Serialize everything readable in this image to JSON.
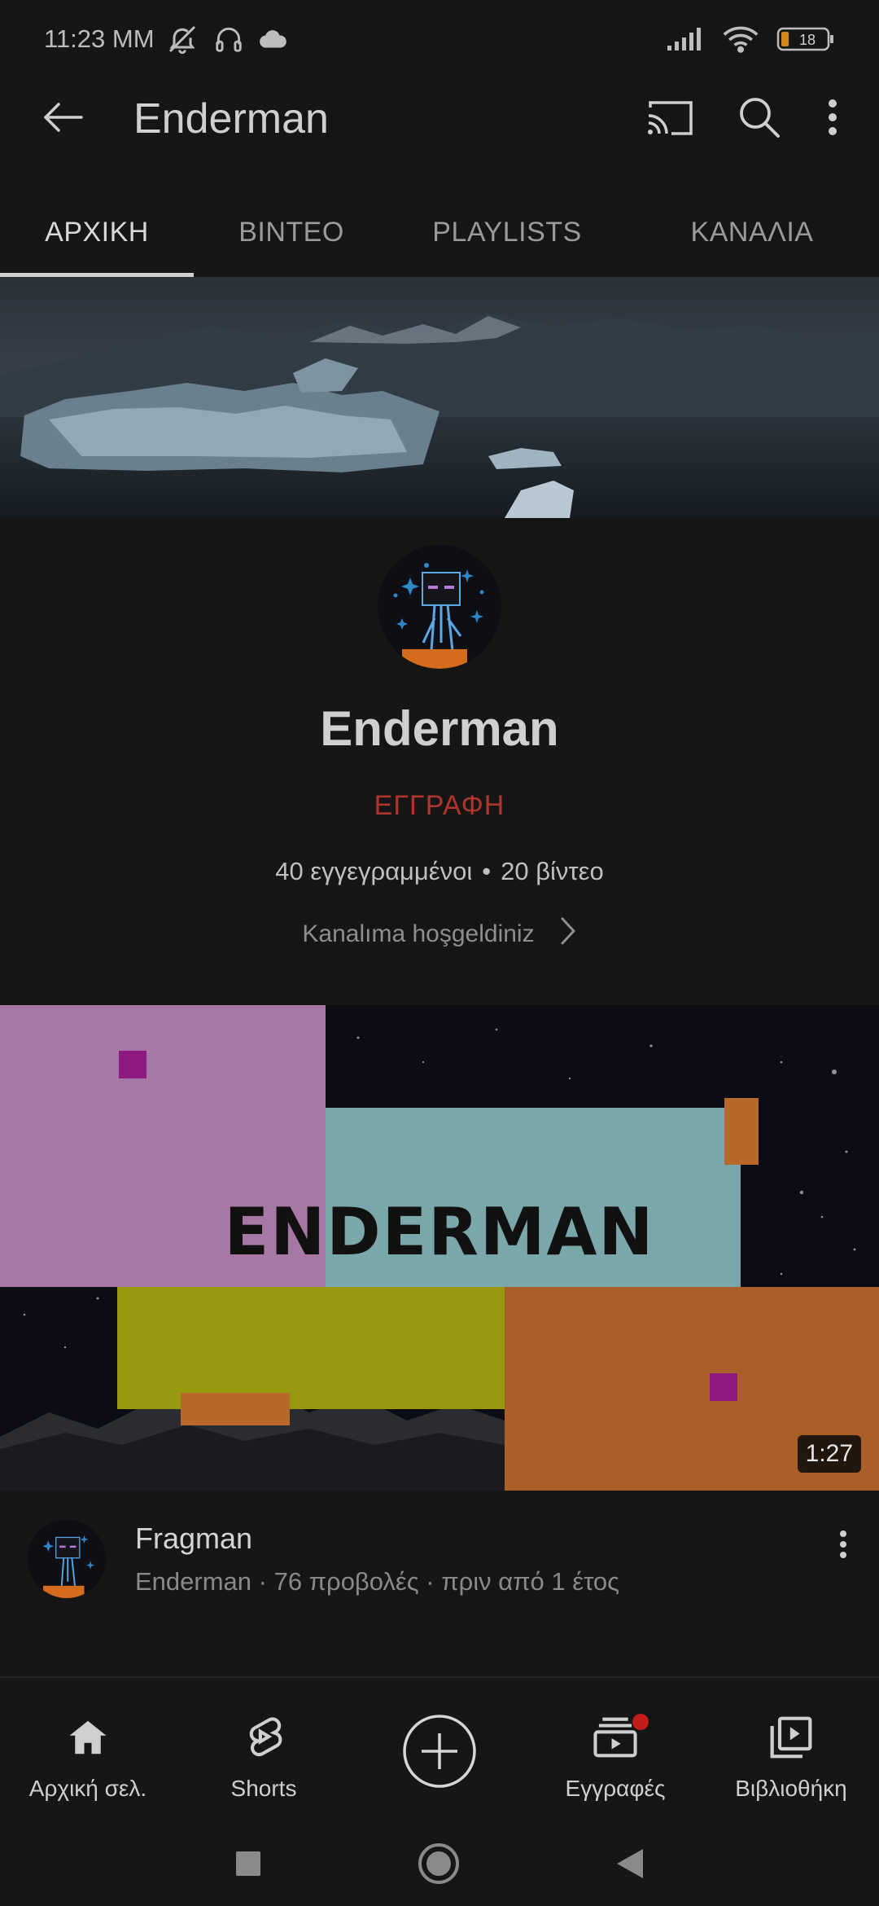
{
  "status_bar": {
    "time": "11:23 ΜΜ",
    "battery_level": "18",
    "icons": [
      "muted-bell-icon",
      "headphones-icon",
      "cloud-icon",
      "signal-icon",
      "wifi-icon",
      "battery-icon"
    ]
  },
  "header": {
    "title": "Enderman",
    "icons": [
      "back-arrow-icon",
      "cast-icon",
      "search-icon",
      "more-vert-icon"
    ]
  },
  "tabs": [
    {
      "label": "ΑΡΧΙΚΗ",
      "active": true
    },
    {
      "label": "ΒΙΝΤΕΟ",
      "active": false
    },
    {
      "label": "PLAYLISTS",
      "active": false
    },
    {
      "label": "ΚΑΝΑΛΙΑ",
      "active": false
    }
  ],
  "channel": {
    "name": "Enderman",
    "subscribe_label": "ΕΓΓΡΑΦΗ",
    "subscribers": "40 εγγεγραμμένοι",
    "video_count": "20 βίντεο",
    "tagline": "Kanalıma hoşgeldiniz"
  },
  "featured_video": {
    "thumbnail_text": "ENDERMAN",
    "duration": "1:27",
    "title": "Fragman",
    "meta": "Enderman · 76 προβολές · πριν από 1 έτος"
  },
  "bottom_nav": [
    {
      "label": "Αρχική σελ.",
      "icon": "home-icon"
    },
    {
      "label": "Shorts",
      "icon": "shorts-icon"
    },
    {
      "label": "",
      "icon": "create-plus-icon"
    },
    {
      "label": "Εγγραφές",
      "icon": "subscriptions-icon"
    },
    {
      "label": "Βιβλιοθήκη",
      "icon": "library-icon"
    }
  ],
  "colors": {
    "background": "#161616",
    "subscribe_red": "#b0352d",
    "badge_red": "#c51b1b"
  }
}
